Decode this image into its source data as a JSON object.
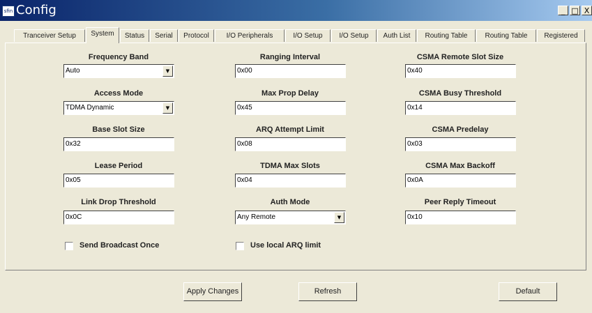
{
  "window": {
    "icon_text": "sfin",
    "title": "Config",
    "min_glyph": "_",
    "max_glyph": "□",
    "close_glyph": "X"
  },
  "tabs": [
    {
      "label": "Tranceiver Setup",
      "active": false
    },
    {
      "label": "System",
      "active": true
    },
    {
      "label": "Status",
      "active": false
    },
    {
      "label": "Serial",
      "active": false
    },
    {
      "label": "Protocol",
      "active": false
    },
    {
      "label": "I/O Peripherals",
      "active": false
    },
    {
      "label": "I/O Setup",
      "active": false
    },
    {
      "label": "I/O Setup",
      "active": false
    },
    {
      "label": "Auth List",
      "active": false
    },
    {
      "label": "Routing Table",
      "active": false
    },
    {
      "label": "Routing Table",
      "active": false
    },
    {
      "label": "Registered",
      "active": false
    }
  ],
  "fields": {
    "frequency_band": {
      "label": "Frequency Band",
      "value": "Auto"
    },
    "access_mode": {
      "label": "Access Mode",
      "value": "TDMA Dynamic"
    },
    "base_slot_size": {
      "label": "Base Slot Size",
      "value": "0x32"
    },
    "lease_period": {
      "label": "Lease Period",
      "value": "0x05"
    },
    "link_drop_threshold": {
      "label": "Link Drop Threshold",
      "value": "0x0C"
    },
    "ranging_interval": {
      "label": "Ranging Interval",
      "value": "0x00"
    },
    "max_prop_delay": {
      "label": "Max Prop Delay",
      "value": "0x45"
    },
    "arq_attempt_limit": {
      "label": "ARQ Attempt Limit",
      "value": "0x08"
    },
    "tdma_max_slots": {
      "label": "TDMA Max Slots",
      "value": "0x04"
    },
    "auth_mode": {
      "label": "Auth Mode",
      "value": "Any Remote"
    },
    "csma_remote_slot_size": {
      "label": "CSMA Remote Slot Size",
      "value": "0x40"
    },
    "csma_busy_threshold": {
      "label": "CSMA Busy Threshold",
      "value": "0x14"
    },
    "csma_predelay": {
      "label": "CSMA Predelay",
      "value": "0x03"
    },
    "csma_max_backoff": {
      "label": "CSMA Max Backoff",
      "value": "0x0A"
    },
    "peer_reply_timeout": {
      "label": "Peer Reply Timeout",
      "value": "0x10"
    }
  },
  "checkboxes": {
    "send_broadcast_once": {
      "label": "Send Broadcast Once",
      "checked": false
    },
    "use_local_arq_limit": {
      "label": "Use local ARQ limit",
      "checked": false
    }
  },
  "buttons": {
    "apply": "Apply Changes",
    "refresh": "Refresh",
    "default": "Default"
  },
  "icons": {
    "dropdown": "▼",
    "window_controls": [
      "minimize-icon",
      "maximize-icon",
      "close-icon"
    ]
  }
}
